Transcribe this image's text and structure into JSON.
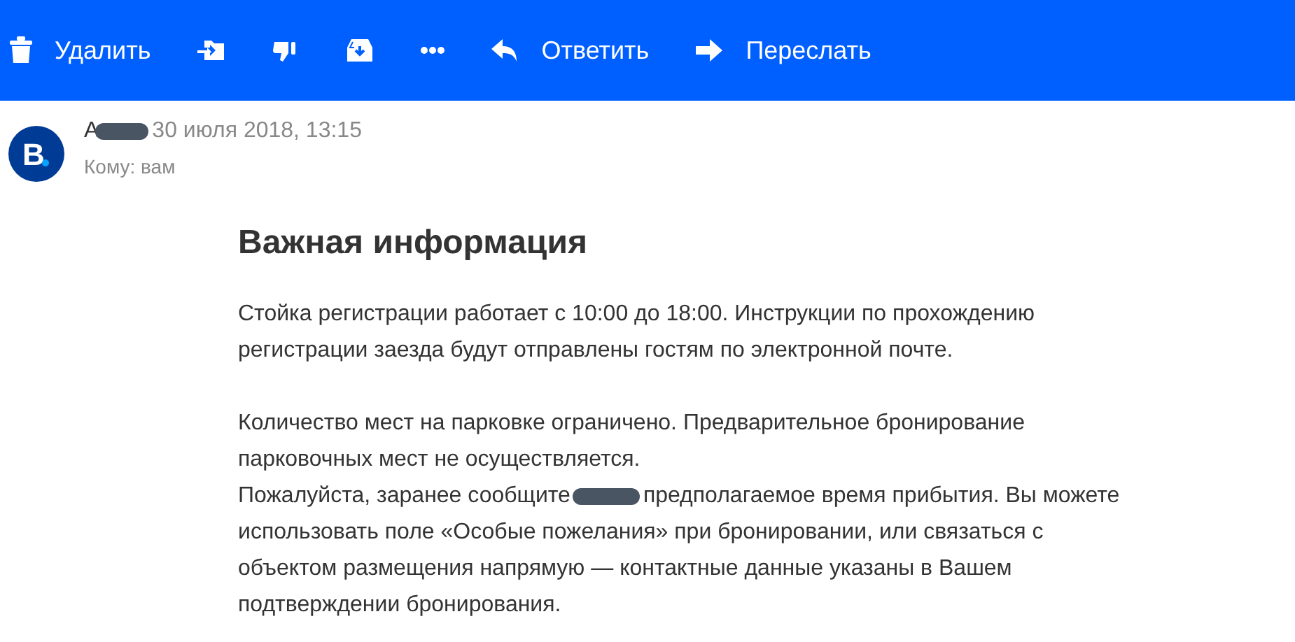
{
  "toolbar": [
    {
      "kind": "trash",
      "label": "Удалить"
    },
    {
      "kind": "move"
    },
    {
      "kind": "spam"
    },
    {
      "kind": "archive"
    },
    {
      "kind": "more"
    },
    {
      "kind": "reply",
      "label": "Ответить"
    },
    {
      "kind": "forward",
      "label": "Переслать"
    }
  ],
  "message": {
    "avatar_letter": "B",
    "sender_visible": "A",
    "date": "30 июля 2018, 13:15",
    "recipient": "Кому: вам",
    "heading": "Важная информация",
    "paragraphs": [
      {
        "lines": [
          {
            "parts": [
              "Стойка регистрации работает с 10:00 до 18:00. Инструкции по прохождению регистрации заезда будут отправлены гостям по электронной почте."
            ]
          }
        ]
      },
      {
        "lines": [
          {
            "parts": [
              "Количество мест на парковке ограничено. Предварительное бронирование парковочных мест не осуществляется."
            ]
          },
          {
            "parts": [
              "Пожалуйста, заранее сообщите",
              "предполагаемое время прибытия. Вы можете"
            ]
          },
          {
            "parts": [
              "использовать поле «Особые пожелания» при бронировании, или связаться с объектом размещения напрямую — контактные данные указаны в Вашем подтверждении бронирования."
            ]
          }
        ]
      }
    ]
  }
}
